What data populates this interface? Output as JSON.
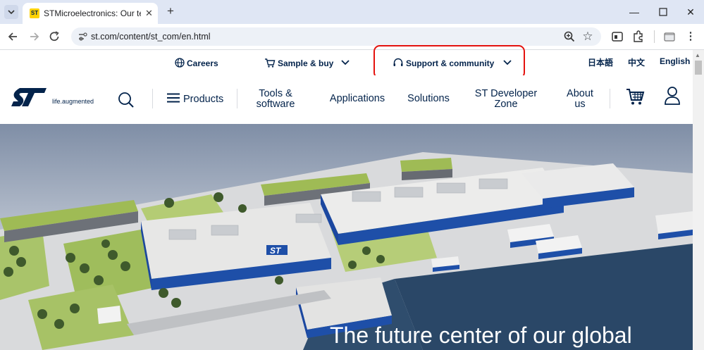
{
  "browser": {
    "tab_title": "STMicroelectronics: Our technology",
    "tab_favicon": "ST",
    "url": "st.com/content/st_com/en.html"
  },
  "utility_bar": {
    "careers": "Careers",
    "sample_buy": "Sample & buy",
    "support": "Support & community",
    "lang_ja": "日本語",
    "lang_zh": "中文",
    "lang_en": "English"
  },
  "main_nav": {
    "logo_text": "ST",
    "tagline": "life.augmented",
    "products": "Products",
    "tools_1": "Tools &",
    "tools_2": "software",
    "applications": "Applications",
    "solutions": "Solutions",
    "devzone_1": "ST Developer",
    "devzone_2": "Zone",
    "about_1": "About",
    "about_2": "us"
  },
  "hero": {
    "building_logo": "ST",
    "headline": "The future center of our global"
  },
  "colors": {
    "brand_navy": "#03234b",
    "brand_blue": "#1e4fa8",
    "highlight_red": "#e4120e",
    "favicon_yellow": "#ffd200"
  }
}
